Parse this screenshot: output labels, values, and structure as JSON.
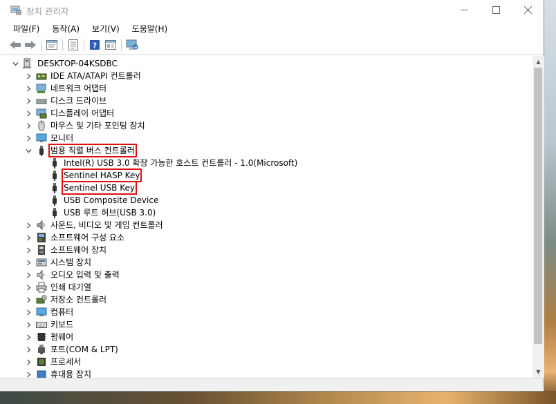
{
  "window": {
    "title": "장치 관리자",
    "minimize_glyph": "—",
    "maximize_glyph": "☐",
    "close_glyph": "✕"
  },
  "menu": [
    {
      "label": "파일(F)"
    },
    {
      "label": "동작(A)"
    },
    {
      "label": "보기(V)"
    },
    {
      "label": "도움말(H)"
    }
  ],
  "toolbar": {
    "buttons": [
      "back-icon",
      "forward-icon",
      "properties-icon",
      "details-icon",
      "help-icon",
      "view-icon",
      "scan-icon"
    ]
  },
  "tree": {
    "root": {
      "label": "DESKTOP-04KSDBC",
      "icon": "computer-icon",
      "expanded": true
    },
    "categories": [
      {
        "label": "IDE ATA/ATAPI 컨트롤러",
        "icon": "ide-controller-icon"
      },
      {
        "label": "네트워크 어댑터",
        "icon": "network-adapter-icon"
      },
      {
        "label": "디스크 드라이브",
        "icon": "disk-drive-icon"
      },
      {
        "label": "디스플레이 어댑터",
        "icon": "display-adapter-icon"
      },
      {
        "label": "마우스 및 기타 포인팅 장치",
        "icon": "mouse-icon"
      },
      {
        "label": "모니터",
        "icon": "monitor-icon"
      },
      {
        "label": "범용 직렬 버스 컨트롤러",
        "icon": "usb-icon",
        "expanded": true,
        "highlighted": true
      },
      {
        "label": "사운드, 비디오 및 게임 컨트롤러",
        "icon": "speaker-icon"
      },
      {
        "label": "소프트웨어 구성 요소",
        "icon": "software-component-icon"
      },
      {
        "label": "소프트웨어 장치",
        "icon": "software-device-icon"
      },
      {
        "label": "시스템 장치",
        "icon": "system-device-icon"
      },
      {
        "label": "오디오 입력 및 출력",
        "icon": "audio-io-icon"
      },
      {
        "label": "인쇄 대기열",
        "icon": "printer-icon"
      },
      {
        "label": "저장소 컨트롤러",
        "icon": "storage-controller-icon"
      },
      {
        "label": "컴퓨터",
        "icon": "computer-monitor-icon"
      },
      {
        "label": "키보드",
        "icon": "keyboard-icon"
      },
      {
        "label": "펌웨어",
        "icon": "firmware-icon"
      },
      {
        "label": "포트(COM & LPT)",
        "icon": "port-icon"
      },
      {
        "label": "프로세서",
        "icon": "processor-icon"
      },
      {
        "label": "휴대용 장치",
        "icon": "portable-device-icon"
      }
    ],
    "usb_children": [
      {
        "label": "Intel(R) USB 3.0 확장 가능한 호스트 컨트롤러 - 1.0(Microsoft)",
        "highlighted": false
      },
      {
        "label": "Sentinel HASP Key",
        "highlighted": true
      },
      {
        "label": "Sentinel USB Key",
        "highlighted": true
      },
      {
        "label": "USB Composite Device",
        "highlighted": false
      },
      {
        "label": "USB 루트 허브(USB 3.0)",
        "highlighted": false
      }
    ]
  },
  "colors": {
    "highlight_border": "#e01010",
    "title_text": "#999999",
    "scroll_track": "#f0f0f0",
    "scroll_thumb": "#c2c2c2"
  }
}
